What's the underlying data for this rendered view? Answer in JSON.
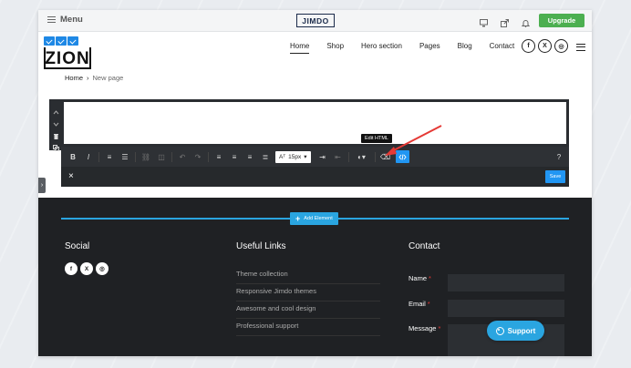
{
  "admin_bar": {
    "menu_label": "Menu",
    "brand": "JIMDO",
    "upgrade_label": "Upgrade"
  },
  "site": {
    "logo": "ZION",
    "nav": [
      "Home",
      "Shop",
      "Hero section",
      "Pages",
      "Blog",
      "Contact"
    ],
    "social": [
      "f",
      "X",
      "◎"
    ]
  },
  "breadcrumb": {
    "home": "Home",
    "separator": "›",
    "current": "New page"
  },
  "toolbar": {
    "font_size": "15px",
    "tooltip": "Edit HTML",
    "help": "?",
    "save_label": "Save",
    "close": "×"
  },
  "footer": {
    "add_element": "Add Element",
    "social_title": "Social",
    "links_title": "Useful Links",
    "links": [
      "Theme collection",
      "Responsive Jimdo themes",
      "Awesome and cool design",
      "Professional support"
    ],
    "contact_title": "Contact",
    "name_label": "Name",
    "email_label": "Email",
    "message_label": "Message",
    "required_mark": "*"
  },
  "support_label": "Support",
  "colors": {
    "accent": "#2aa5e0",
    "upgrade": "#4caf50",
    "footer_bg": "#1f2124",
    "arrow": "#e53935"
  }
}
